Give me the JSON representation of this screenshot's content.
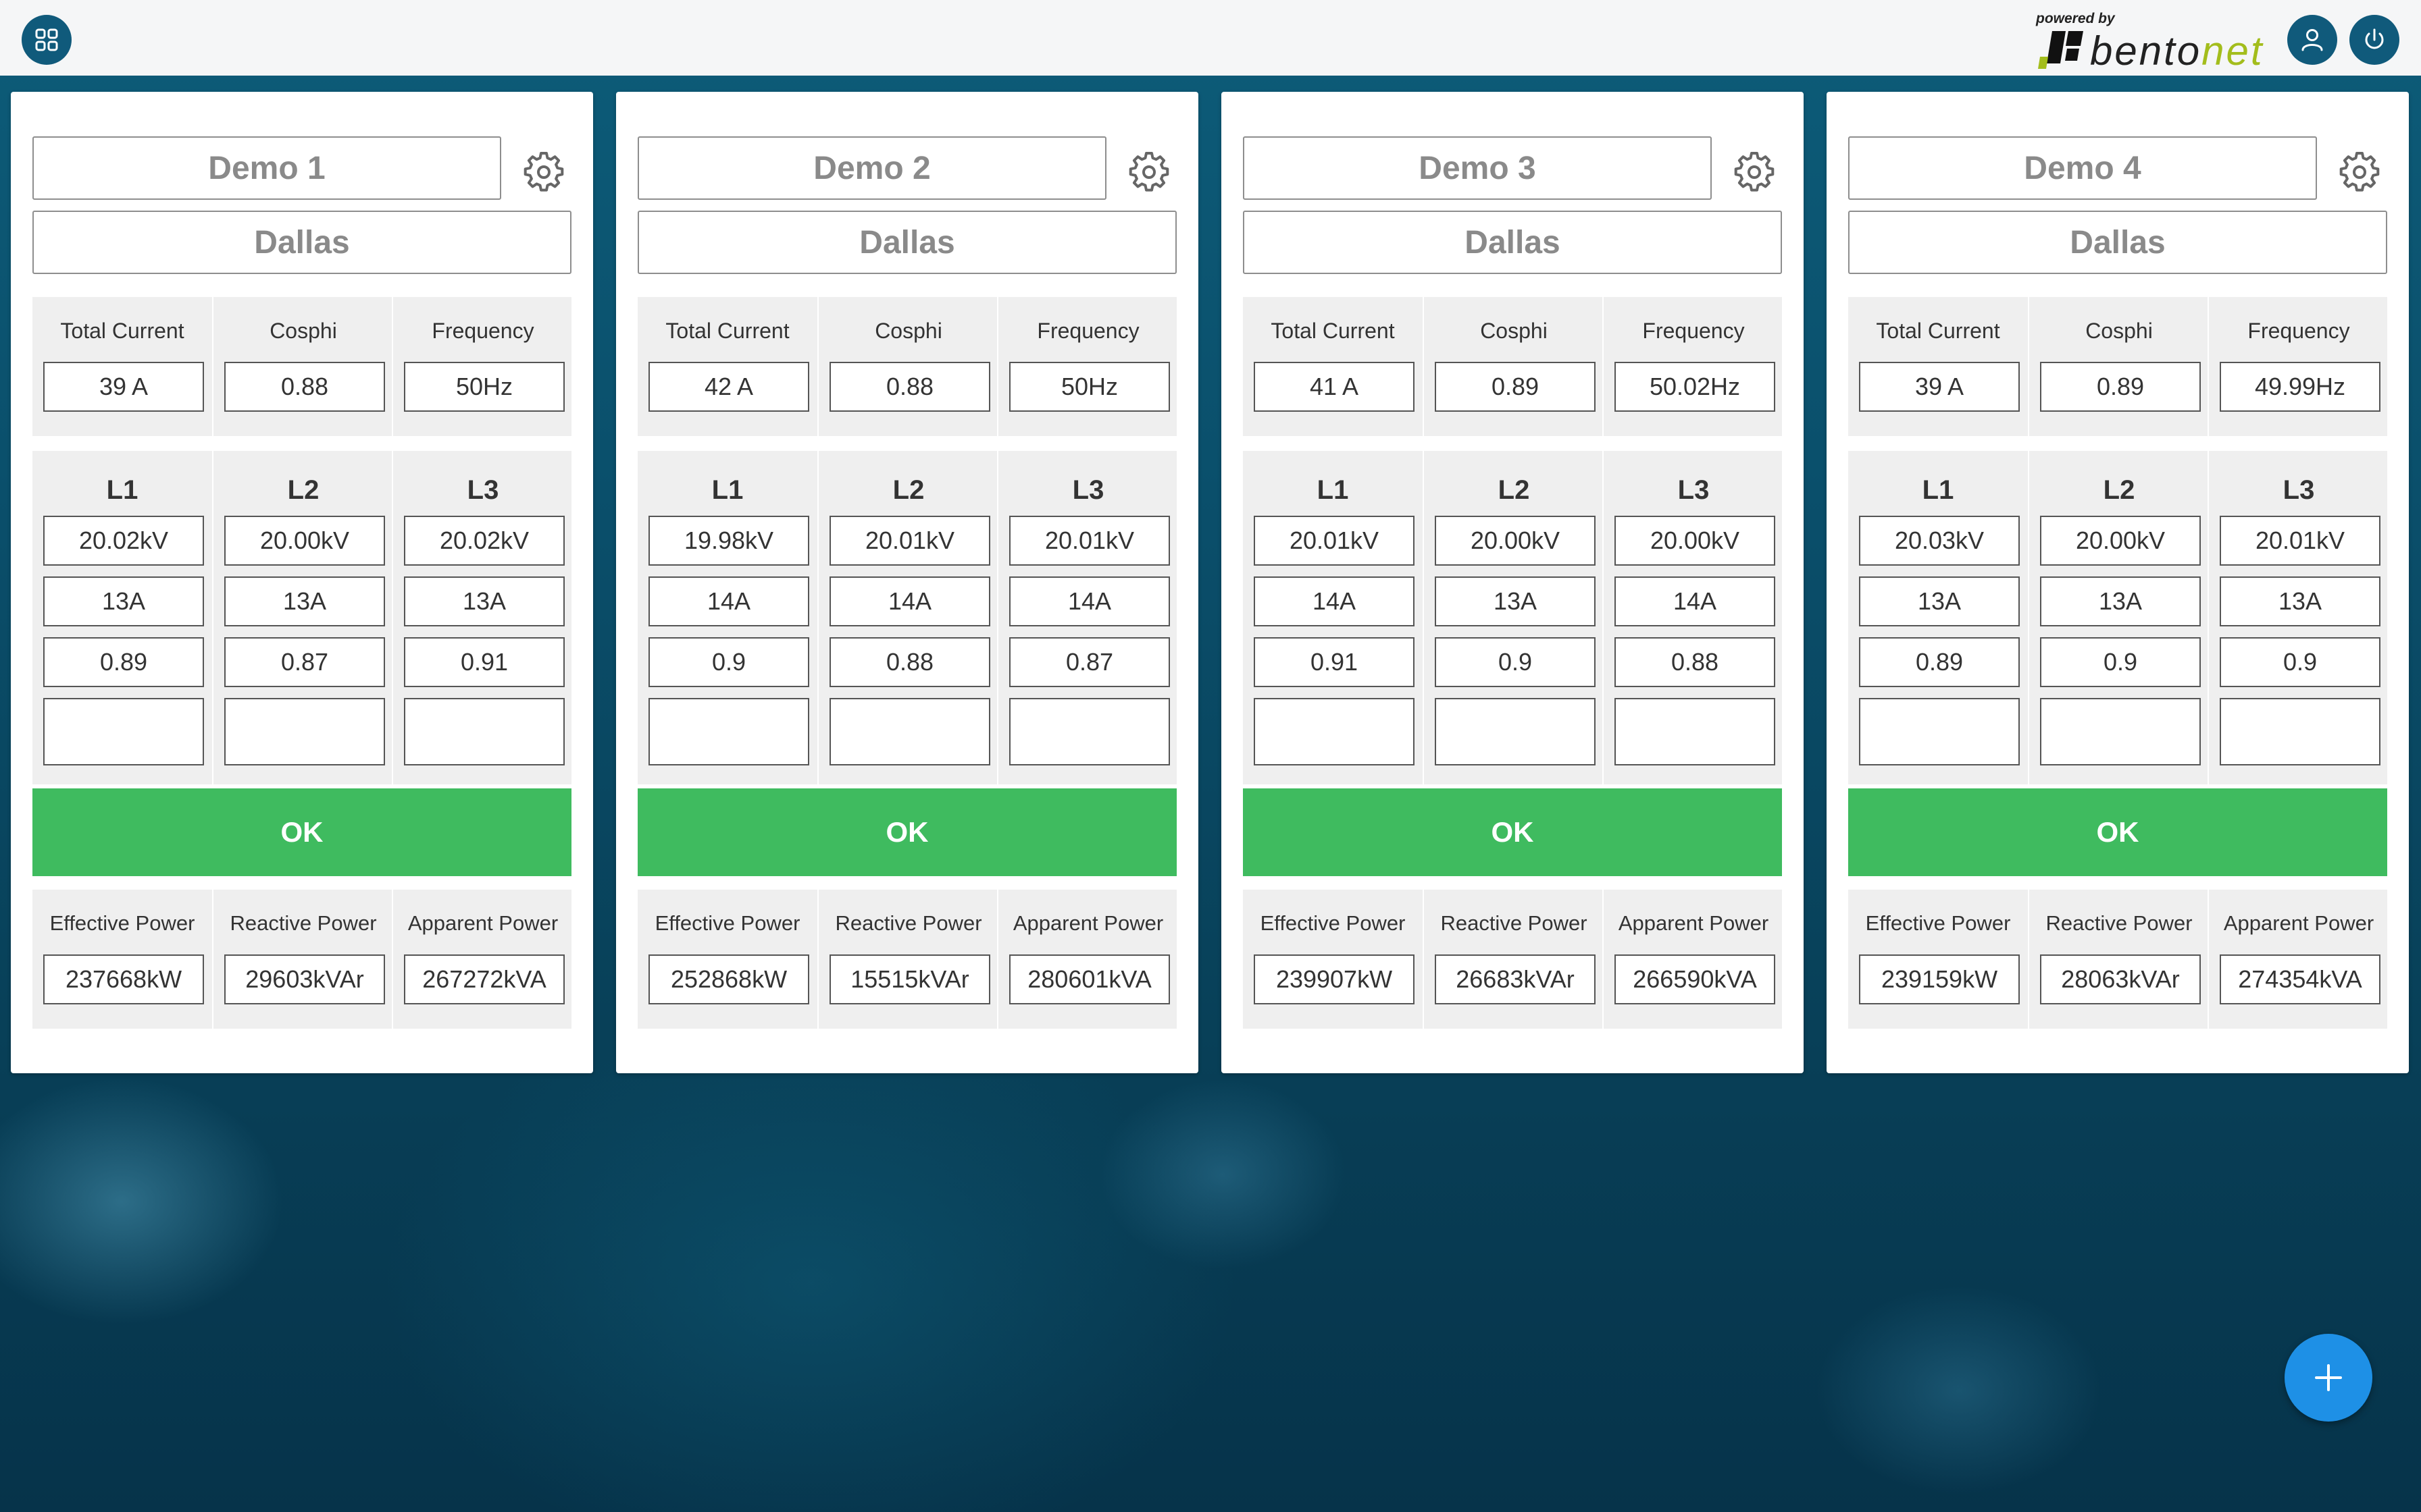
{
  "brand": {
    "powered_by": "powered by",
    "name_a": "bento",
    "name_b": "net"
  },
  "labels": {
    "total_current": "Total Current",
    "cosphi": "Cosphi",
    "frequency": "Frequency",
    "l1": "L1",
    "l2": "L2",
    "l3": "L3",
    "effective_power": "Effective Power",
    "reactive_power": "Reactive Power",
    "apparent_power": "Apparent Power"
  },
  "cards": [
    {
      "name": "Demo 1",
      "city": "Dallas",
      "total_current": "39 A",
      "cosphi": "0.88",
      "frequency": "50Hz",
      "l1": {
        "voltage": "20.02kV",
        "current": "13A",
        "cosphi": "0.89",
        "extra": ""
      },
      "l2": {
        "voltage": "20.00kV",
        "current": "13A",
        "cosphi": "0.87",
        "extra": ""
      },
      "l3": {
        "voltage": "20.02kV",
        "current": "13A",
        "cosphi": "0.91",
        "extra": ""
      },
      "status": "OK",
      "effective_power": "237668kW",
      "reactive_power": "29603kVAr",
      "apparent_power": "267272kVA"
    },
    {
      "name": "Demo 2",
      "city": "Dallas",
      "total_current": "42 A",
      "cosphi": "0.88",
      "frequency": "50Hz",
      "l1": {
        "voltage": "19.98kV",
        "current": "14A",
        "cosphi": "0.9",
        "extra": ""
      },
      "l2": {
        "voltage": "20.01kV",
        "current": "14A",
        "cosphi": "0.88",
        "extra": ""
      },
      "l3": {
        "voltage": "20.01kV",
        "current": "14A",
        "cosphi": "0.87",
        "extra": ""
      },
      "status": "OK",
      "effective_power": "252868kW",
      "reactive_power": "15515kVAr",
      "apparent_power": "280601kVA"
    },
    {
      "name": "Demo 3",
      "city": "Dallas",
      "total_current": "41 A",
      "cosphi": "0.89",
      "frequency": "50.02Hz",
      "l1": {
        "voltage": "20.01kV",
        "current": "14A",
        "cosphi": "0.91",
        "extra": ""
      },
      "l2": {
        "voltage": "20.00kV",
        "current": "13A",
        "cosphi": "0.9",
        "extra": ""
      },
      "l3": {
        "voltage": "20.00kV",
        "current": "14A",
        "cosphi": "0.88",
        "extra": ""
      },
      "status": "OK",
      "effective_power": "239907kW",
      "reactive_power": "26683kVAr",
      "apparent_power": "266590kVA"
    },
    {
      "name": "Demo 4",
      "city": "Dallas",
      "total_current": "39 A",
      "cosphi": "0.89",
      "frequency": "49.99Hz",
      "l1": {
        "voltage": "20.03kV",
        "current": "13A",
        "cosphi": "0.89",
        "extra": ""
      },
      "l2": {
        "voltage": "20.00kV",
        "current": "13A",
        "cosphi": "0.9",
        "extra": ""
      },
      "l3": {
        "voltage": "20.01kV",
        "current": "13A",
        "cosphi": "0.9",
        "extra": ""
      },
      "status": "OK",
      "effective_power": "239159kW",
      "reactive_power": "28063kVAr",
      "apparent_power": "274354kVA"
    }
  ],
  "icons": {
    "apps": "grid-icon",
    "user": "user-icon",
    "power": "power-icon",
    "settings": "gear-icon",
    "add": "plus-icon"
  },
  "colors": {
    "primary": "#105a7b",
    "ok": "#3fbb5f",
    "fab": "#1e90e6",
    "brand_accent": "#a3bd1c"
  }
}
